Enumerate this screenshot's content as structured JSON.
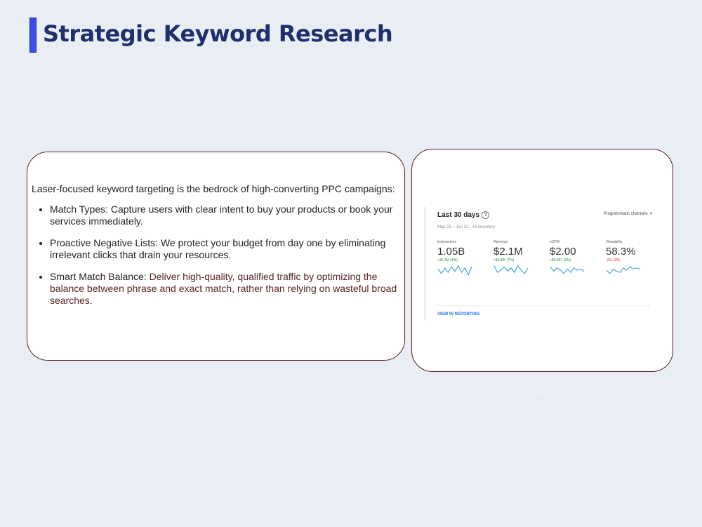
{
  "slide": {
    "title": "Strategic Keyword Research"
  },
  "text_card": {
    "intro": "Laser-focused keyword targeting is the bedrock of high-converting PPC campaigns:",
    "bullets": [
      {
        "lead": "Match Types: Capture users with clear intent to buy your products or book your services immediately.",
        "rest": ""
      },
      {
        "lead": "Proactive Negative Lists: We protect your budget from day one by eliminating irrelevant clicks that drain your resources.",
        "rest": ""
      },
      {
        "lead": "Smart Match Balance: ",
        "rest": "Deliver high-quality, qualified traffic by optimizing the balance between phrase and exact match, rather than relying on wasteful broad searches."
      }
    ]
  },
  "dashboard": {
    "heading": "Last 30 days",
    "help_icon": "?",
    "date_range": "May 23 – Jun 21",
    "scope": "All inventory",
    "selector": "Programmatic channels",
    "selector_icon": "▾",
    "metrics": [
      {
        "label": "Impressions",
        "value": "1.05B",
        "change": "+36.1M (4%)",
        "change_color": "#1e8e3e",
        "spark": [
          0.6,
          0.2,
          0.7,
          0.3,
          0.8,
          0.4,
          0.9,
          0.3,
          0.7,
          0.1,
          0.8
        ]
      },
      {
        "label": "Revenue",
        "value": "$2.1M",
        "change": "+$140K (7%)",
        "change_color": "#1e8e3e",
        "spark": [
          0.9,
          0.3,
          0.5,
          0.8,
          0.4,
          0.7,
          0.3,
          0.9,
          0.5,
          0.2,
          0.7
        ]
      },
      {
        "label": "eCPM",
        "value": "$2.00",
        "change": "+$0.067 (3%)",
        "change_color": "#1e8e3e",
        "spark": [
          0.8,
          0.4,
          0.7,
          0.5,
          0.2,
          0.6,
          0.3,
          0.7,
          0.5,
          0.6,
          0.4
        ]
      },
      {
        "label": "Viewability",
        "value": "58.3%",
        "change": "-2% (3%)",
        "change_color": "#d93025",
        "spark": [
          0.5,
          0.2,
          0.6,
          0.4,
          0.3,
          0.7,
          0.5,
          0.8,
          0.6,
          0.7,
          0.6
        ]
      }
    ],
    "link": "VIEW IN REPORTING",
    "spark_color": "#4aa3df"
  }
}
